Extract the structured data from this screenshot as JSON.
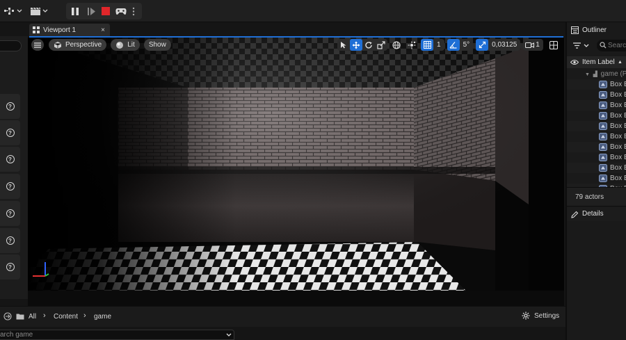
{
  "viewport_tab": {
    "label": "Viewport 1",
    "close": "×"
  },
  "viewport_toolbar": {
    "view_mode": "Perspective",
    "lighting": "Lit",
    "show": "Show",
    "grid_snap": "1",
    "rotate_snap": "5°",
    "scale_snap": "0,03125",
    "camera_speed": "1"
  },
  "outliner": {
    "title": "Outliner",
    "search_placeholder": "Search",
    "column_label": "Item Label",
    "sort_arrow": "▲",
    "folder_label": "game (P",
    "items": [
      "Box B",
      "Box B",
      "Box B",
      "Box B",
      "Box B",
      "Box B",
      "Box B",
      "Box B",
      "Box B",
      "Box B",
      "Box B"
    ],
    "actor_count": "79 actors"
  },
  "details": {
    "title": "Details"
  },
  "content_browser": {
    "breadcrumb": [
      "All",
      "Content",
      "game"
    ],
    "settings_label": "Settings",
    "search_placeholder": "arch game"
  },
  "colors": {
    "accent_blue": "#1f6fd6",
    "stop_red": "#e0262a",
    "panel_bg": "#1a1a1a"
  }
}
